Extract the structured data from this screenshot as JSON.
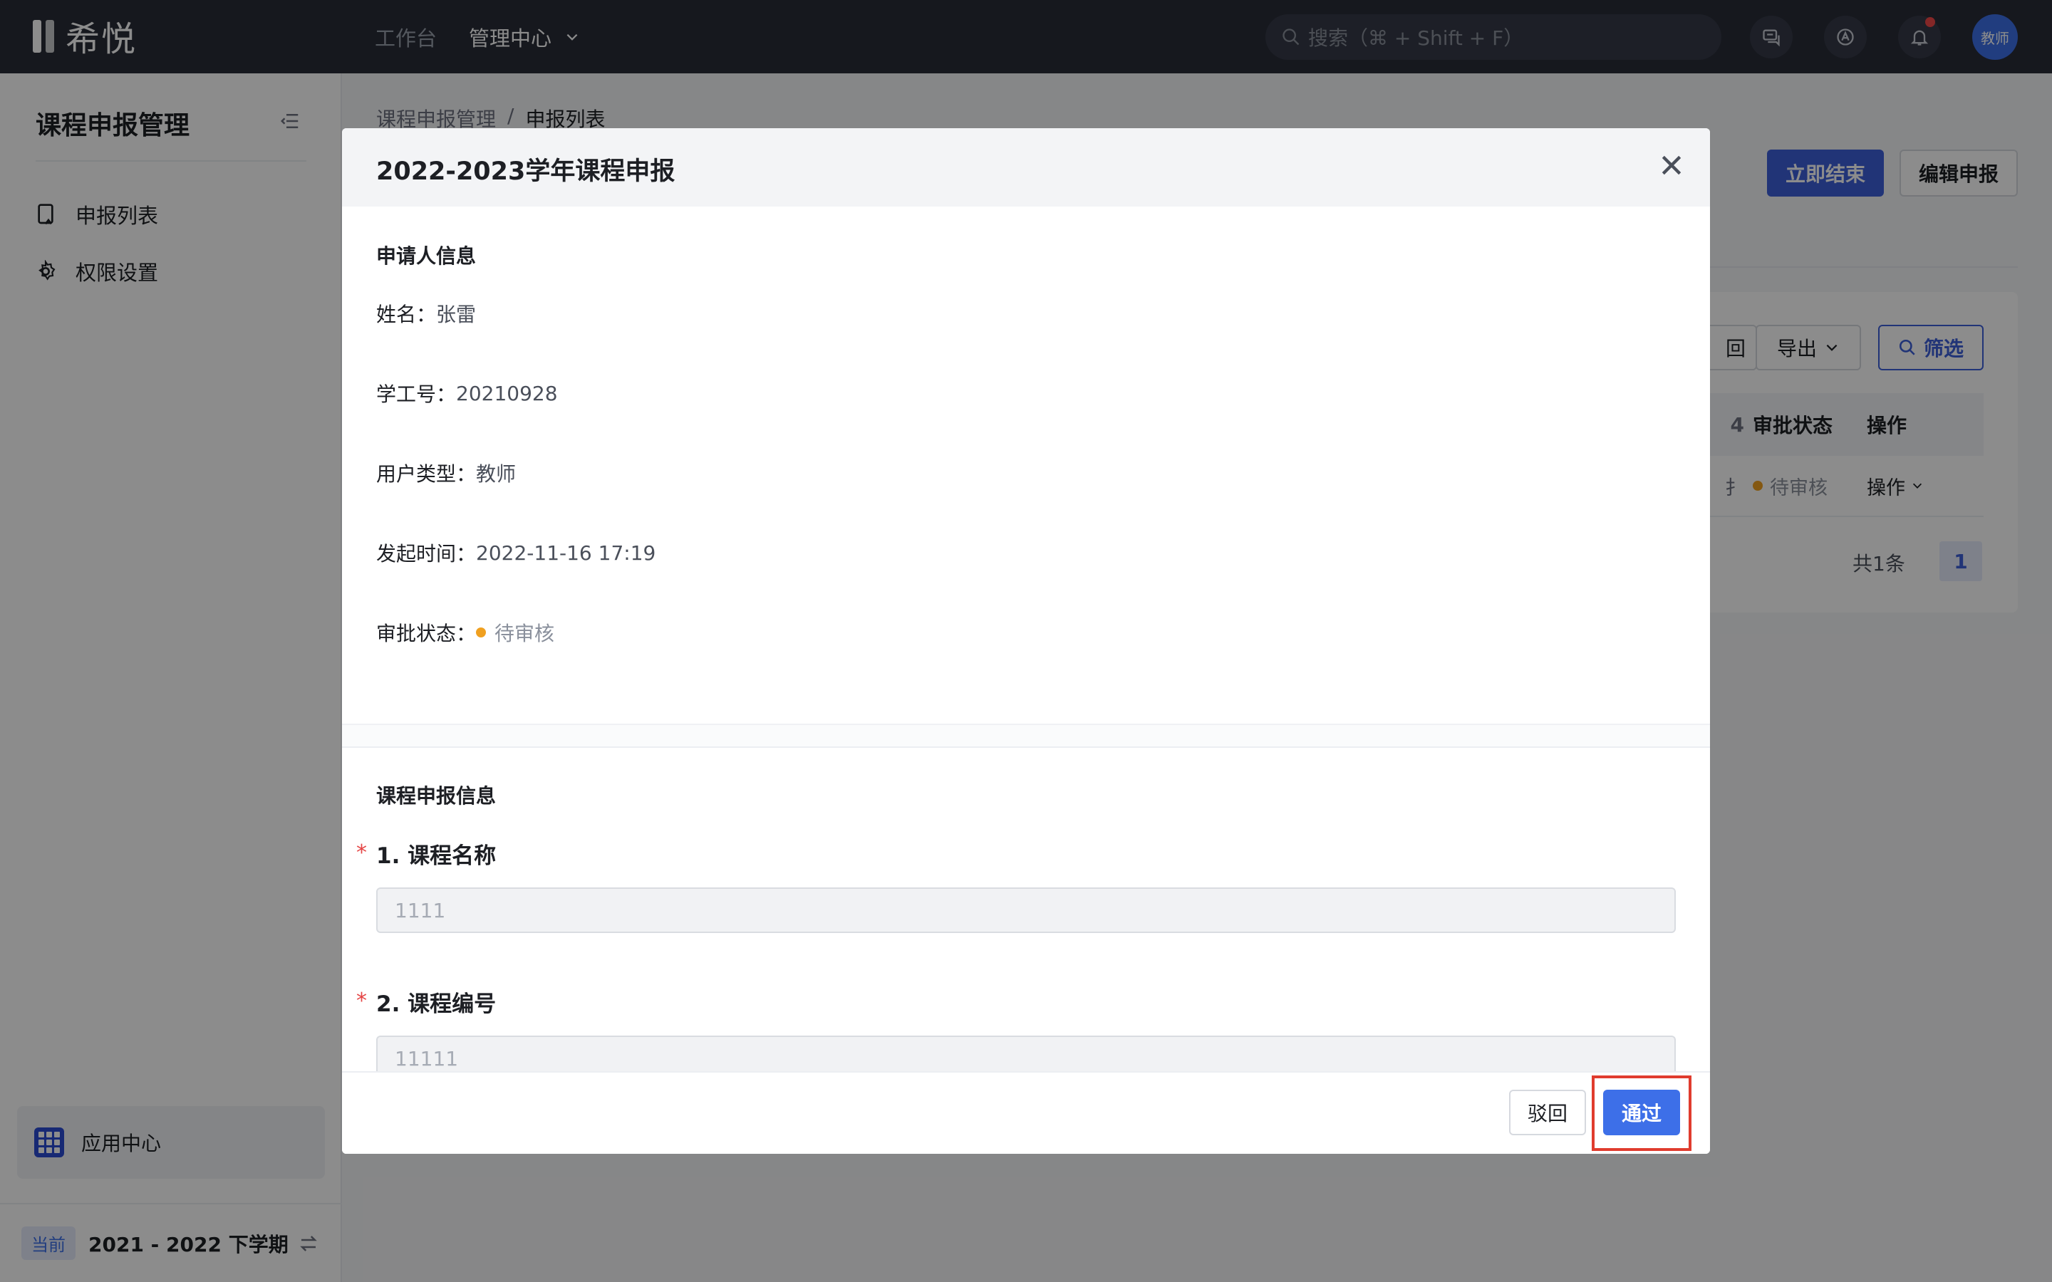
{
  "topbar": {
    "logo_text": "希悦",
    "nav": [
      {
        "label": "工作台"
      },
      {
        "label": "管理中心"
      }
    ],
    "search_placeholder": "搜索（⌘ + Shift + F）",
    "icons": [
      "message-icon",
      "app-icon",
      "bell-icon"
    ],
    "avatar_label": "教师"
  },
  "sidebar": {
    "title": "课程申报管理",
    "items": [
      {
        "label": "申报列表",
        "icon": "list-doc-icon"
      },
      {
        "label": "权限设置",
        "icon": "gear-icon"
      }
    ],
    "app_center": "应用中心",
    "term_badge": "当前",
    "term": "2021 - 2022 下学期"
  },
  "main": {
    "breadcrumb": [
      "课程申报管理",
      "/",
      "申报列表"
    ],
    "end_button": "立即结束",
    "edit_button": "编辑申报",
    "back_partial": "回",
    "export_button": "导出",
    "filter_button": "筛选",
    "table": {
      "partial_col": "4",
      "headers": [
        "审批状态",
        "操作"
      ],
      "row": {
        "partial": "扌",
        "status": "待审核",
        "action": "操作"
      }
    },
    "pager": {
      "total": "共1条",
      "page": "1"
    }
  },
  "modal": {
    "title": "2022-2023学年课程申报",
    "applicant_section": "申请人信息",
    "fields": [
      {
        "label": "姓名：",
        "value": "张雷"
      },
      {
        "label": "学工号：",
        "value": "20210928"
      },
      {
        "label": "用户类型：",
        "value": "教师"
      },
      {
        "label": "发起时间：",
        "value": "2022-11-16 17:19"
      },
      {
        "label": "审批状态：",
        "value": "待审核"
      }
    ],
    "course_section": "课程申报信息",
    "questions": [
      {
        "label": "1. 课程名称",
        "value": "1111"
      },
      {
        "label": "2. 课程编号",
        "value": "11111"
      }
    ],
    "reject_button": "驳回",
    "pass_button": "通过"
  },
  "colors": {
    "topbar": "#282c38",
    "primary": "#3d6fe8",
    "pending": "#f0a020",
    "highlight": "#e03c2e"
  }
}
